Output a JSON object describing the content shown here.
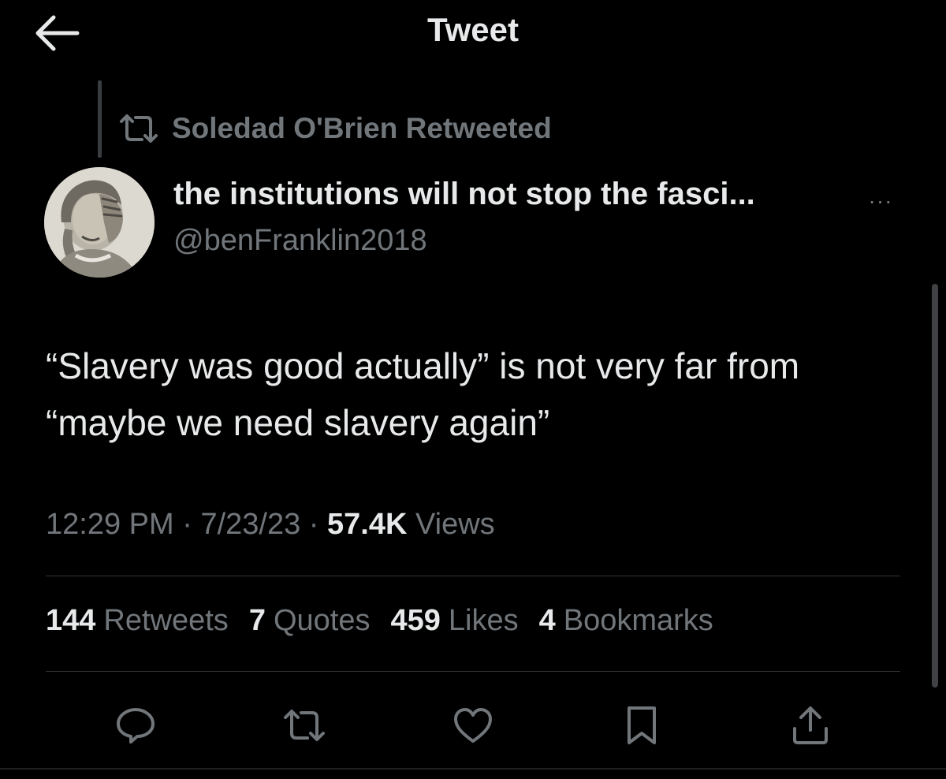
{
  "header": {
    "title": "Tweet",
    "back_icon": "arrow-left-icon"
  },
  "retweet_context": {
    "icon": "retweet-icon",
    "label": "Soledad O'Brien Retweeted"
  },
  "author": {
    "display_name": "the institutions will not stop the fasci...",
    "handle": "@benFranklin2018",
    "avatar": "avatar-image"
  },
  "more_menu": {
    "label": "···"
  },
  "tweet": {
    "text": "“Slavery was good actually” is not very far from “maybe we need slavery again”",
    "time": "12:29 PM",
    "separator": "·",
    "date": "7/23/23",
    "views_count": "57.4K",
    "views_label": "Views"
  },
  "stats": [
    {
      "count": "144",
      "label": "Retweets"
    },
    {
      "count": "7",
      "label": "Quotes"
    },
    {
      "count": "459",
      "label": "Likes"
    },
    {
      "count": "4",
      "label": "Bookmarks"
    }
  ],
  "actions": [
    {
      "name": "reply",
      "icon": "reply-icon"
    },
    {
      "name": "retweet",
      "icon": "retweet-icon"
    },
    {
      "name": "like",
      "icon": "heart-icon"
    },
    {
      "name": "bookmark",
      "icon": "bookmark-icon"
    },
    {
      "name": "share",
      "icon": "share-icon"
    }
  ],
  "colors": {
    "background": "#000000",
    "primary_text": "#e7e9ea",
    "secondary_text": "#71767b",
    "divider": "#2f3336"
  }
}
